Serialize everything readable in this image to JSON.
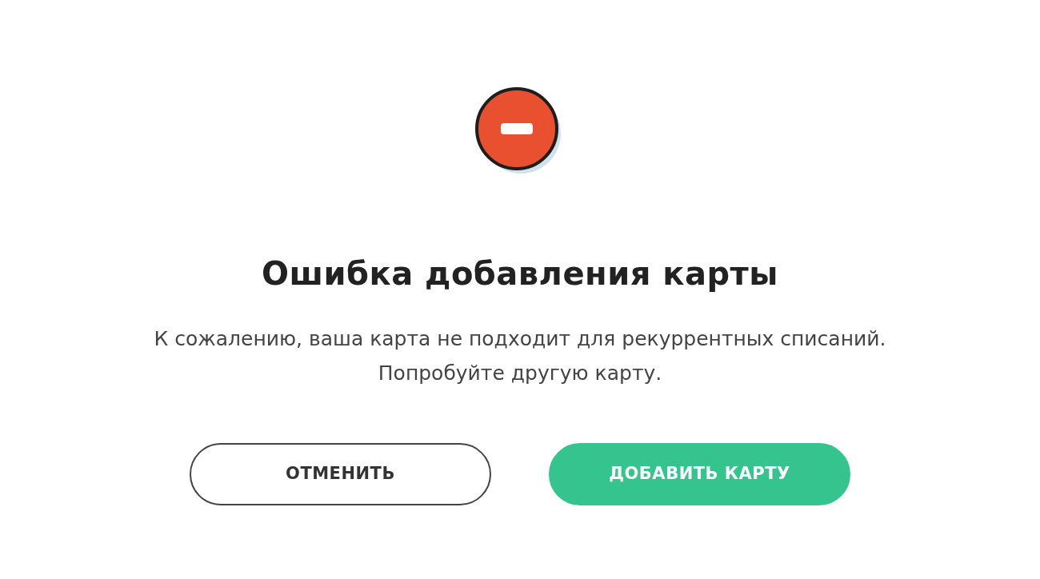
{
  "title": "Ошибка добавления карты",
  "message_lines": [
    "К сожалению, ваша карта не подходит для рекуррентных списаний.",
    "Попробуйте другую карту."
  ],
  "buttons": [
    {
      "label": "ОТМЕНИТЬ",
      "kind": "outline"
    },
    {
      "label": "ДОБАВИТЬ КАРТУ",
      "kind": "primary"
    }
  ]
}
